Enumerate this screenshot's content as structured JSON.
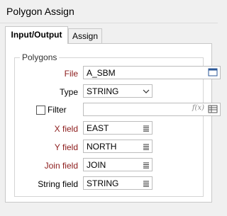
{
  "window": {
    "title": "Polygon Assign"
  },
  "tabs": [
    {
      "label": "Input/Output"
    },
    {
      "label": "Assign"
    }
  ],
  "polygons": {
    "group_title": "Polygons",
    "file": {
      "label": "File",
      "value": "A_SBM"
    },
    "type": {
      "label": "Type",
      "value": "STRING"
    },
    "filter": {
      "label": "Filter",
      "checked": false,
      "value": ""
    },
    "x_field": {
      "label": "X field",
      "value": "EAST"
    },
    "y_field": {
      "label": "Y field",
      "value": "NORTH"
    },
    "join_field": {
      "label": "Join field",
      "value": "JOIN"
    },
    "string_field": {
      "label": "String field",
      "value": "STRING"
    }
  }
}
